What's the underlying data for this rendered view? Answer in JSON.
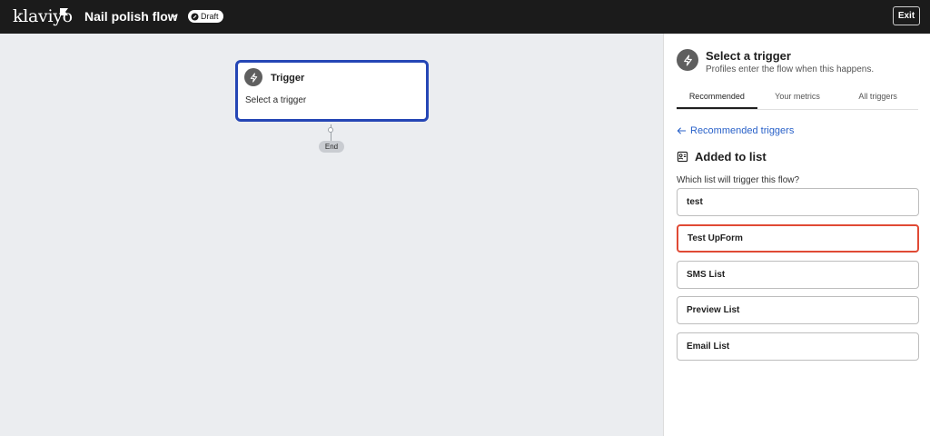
{
  "header": {
    "logo_text": "klaviyo",
    "flow_title": "Nail polish flow",
    "status_badge": "Draft",
    "exit_label": "Exit"
  },
  "canvas": {
    "trigger_title": "Trigger",
    "trigger_subtitle": "Select a trigger",
    "end_label": "End"
  },
  "panel": {
    "title": "Select a trigger",
    "subtitle": "Profiles enter the flow when this happens.",
    "tabs": [
      {
        "label": "Recommended",
        "active": true
      },
      {
        "label": "Your metrics",
        "active": false
      },
      {
        "label": "All triggers",
        "active": false
      }
    ],
    "back_link": "Recommended triggers",
    "section_heading": "Added to list",
    "question": "Which list will trigger this flow?",
    "options": [
      {
        "label": "test"
      },
      {
        "label": "Test UpForm",
        "highlighted": true
      },
      {
        "label": "SMS List"
      },
      {
        "label": "Preview List"
      },
      {
        "label": "Email List"
      }
    ]
  },
  "colors": {
    "topbar": "#1b1b1b",
    "canvas_bg": "#ebedf0",
    "trigger_border": "#2546b5",
    "link": "#2a62c9",
    "highlight": "#e04a35"
  },
  "icons": {
    "trigger": "lightning-icon",
    "section": "list-contact-icon",
    "back": "arrow-left-icon",
    "badge": "pencil-icon",
    "title_menu": "chevron-down-icon"
  }
}
